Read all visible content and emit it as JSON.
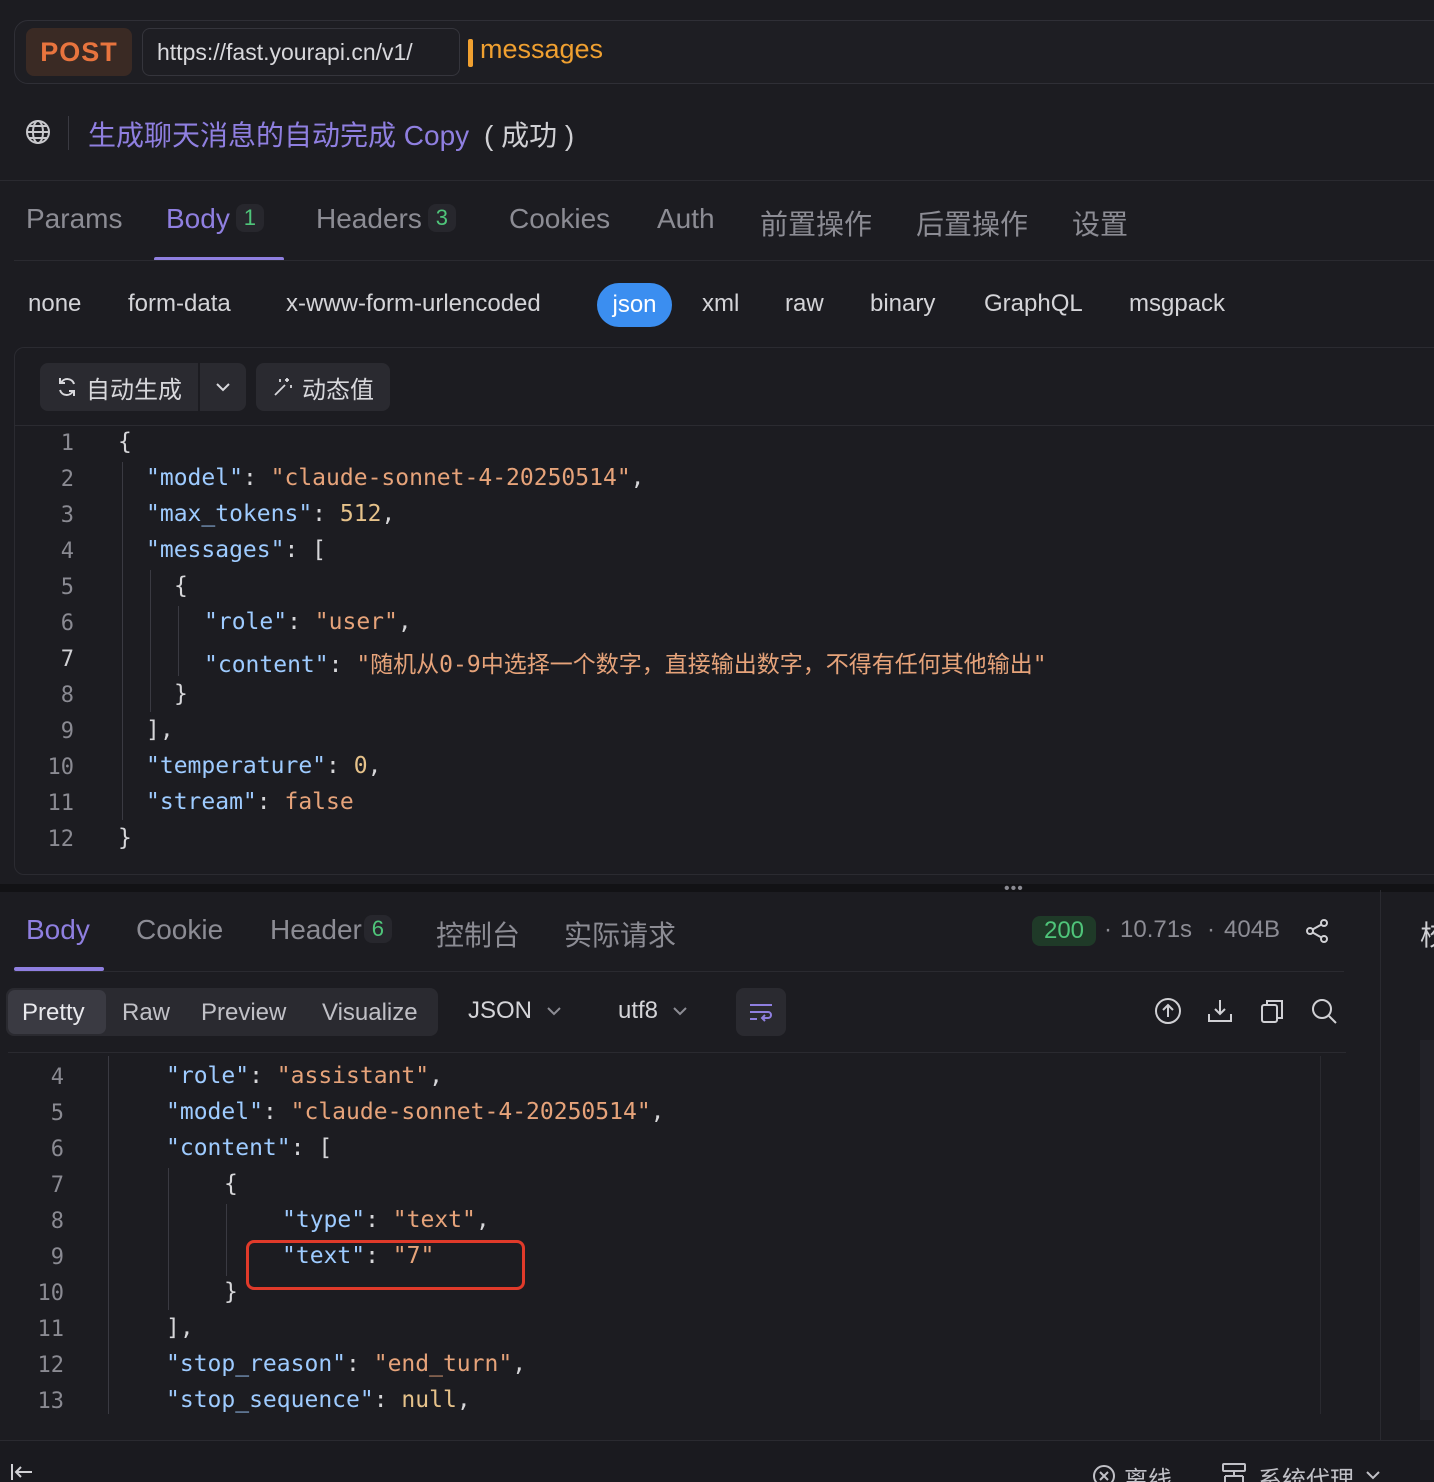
{
  "request": {
    "method": "POST",
    "base_url": "https://fast.yourapi.cn/v1/",
    "path": "messages",
    "title": "生成聊天消息的自动完成 Copy",
    "status_text": "( 成功 )"
  },
  "request_tabs": [
    {
      "label": "Params"
    },
    {
      "label": "Body",
      "badge": "1",
      "active": true
    },
    {
      "label": "Headers",
      "badge": "3"
    },
    {
      "label": "Cookies"
    },
    {
      "label": "Auth"
    },
    {
      "label": "前置操作"
    },
    {
      "label": "后置操作"
    },
    {
      "label": "设置"
    }
  ],
  "body_types": [
    "none",
    "form-data",
    "x-www-form-urlencoded",
    "json",
    "xml",
    "raw",
    "binary",
    "GraphQL",
    "msgpack"
  ],
  "body_type_selected": "json",
  "editor_toolbar": {
    "autogen_label": "自动生成",
    "dynamic_label": "动态值"
  },
  "request_body": {
    "line_numbers": [
      "1",
      "2",
      "3",
      "4",
      "5",
      "6",
      "7",
      "8",
      "9",
      "10",
      "11",
      "12"
    ],
    "current_line": "7",
    "model": "\"claude-sonnet-4-20250514\"",
    "max_tokens": "512",
    "role": "\"user\"",
    "content": "\"随机从0-9中选择一个数字，直接输出数字，不得有任何其他输出\"",
    "temperature": "0",
    "stream": "false"
  },
  "response_tabs": [
    {
      "label": "Body",
      "active": true
    },
    {
      "label": "Cookie"
    },
    {
      "label": "Header",
      "badge": "6"
    },
    {
      "label": "控制台"
    },
    {
      "label": "实际请求"
    }
  ],
  "response_meta": {
    "status": "200",
    "time": "10.71s",
    "size": "404B"
  },
  "view_modes": [
    "Pretty",
    "Raw",
    "Preview",
    "Visualize"
  ],
  "view_mode_selected": "Pretty",
  "format_dropdown": "JSON",
  "encoding_dropdown": "utf8",
  "response_body": {
    "line_numbers": [
      "4",
      "5",
      "6",
      "7",
      "8",
      "9",
      "10",
      "11",
      "12",
      "13"
    ],
    "role": "\"assistant\"",
    "model": "\"claude-sonnet-4-20250514\"",
    "type": "\"text\"",
    "text": "\"7\"",
    "stop_reason": "\"end_turn\"",
    "stop_sequence": "null"
  },
  "right_panel_partial_label": "校",
  "bottom_bar": {
    "offline": "离线",
    "proxy": "系统代理"
  },
  "colors": {
    "accent": "#8f7fe0",
    "method": "#e8743e",
    "path": "#f0a030",
    "success": "#4fc57a",
    "json_pill": "#3b8ef0",
    "highlight": "#e03a2a"
  },
  "icons": [
    "globe-icon",
    "refresh-icon",
    "chevron-down-icon",
    "magic-wand-icon",
    "share-icon",
    "wrap-lines-icon",
    "upload-icon",
    "download-icon",
    "copy-icon",
    "search-icon",
    "offline-icon",
    "proxy-icon",
    "collapse-left-icon"
  ]
}
